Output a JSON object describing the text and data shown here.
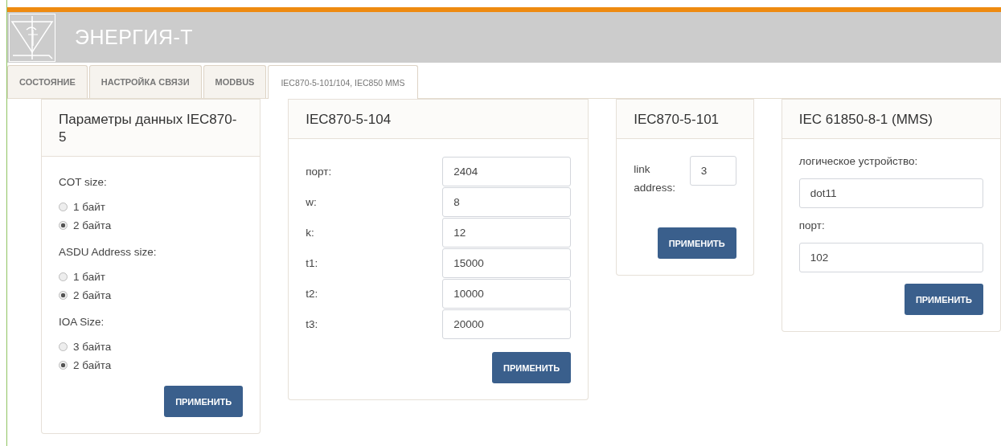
{
  "header": {
    "brand": "ЭНЕРГИЯ-Т"
  },
  "tabs": [
    {
      "label": "СОСТОЯНИЕ",
      "selected": false
    },
    {
      "label": "НАСТРОЙКА СВЯЗИ",
      "selected": false
    },
    {
      "label": "MODBUS",
      "selected": false
    },
    {
      "label": "IEC870-5-101/104, IEC850 MMS",
      "selected": true
    }
  ],
  "panels": [
    {
      "kind": "radios",
      "title": "Параметры данных IEC870-5",
      "groups": [
        {
          "label": "COT size:",
          "options": [
            {
              "label": "1 байт",
              "selected": false
            },
            {
              "label": "2 байта",
              "selected": true
            }
          ]
        },
        {
          "label": "ASDU Address size:",
          "options": [
            {
              "label": "1 байт",
              "selected": false
            },
            {
              "label": "2 байта",
              "selected": true
            }
          ]
        },
        {
          "label": "IOA Size:",
          "options": [
            {
              "label": "3 байта",
              "selected": false
            },
            {
              "label": "2 байта",
              "selected": true
            }
          ]
        }
      ],
      "button": "ПРИМЕНИТЬ"
    },
    {
      "kind": "table",
      "title": "IEC870-5-104",
      "fields": [
        {
          "label": "порт:",
          "value": "2404"
        },
        {
          "label": "w:",
          "value": "8"
        },
        {
          "label": "k:",
          "value": "12"
        },
        {
          "label": "t1:",
          "value": "15000"
        },
        {
          "label": "t2:",
          "value": "10000"
        },
        {
          "label": "t3:",
          "value": "20000"
        }
      ],
      "button": "ПРИМЕНИТЬ"
    },
    {
      "kind": "inline",
      "title": "IEC870-5-101",
      "fields": [
        {
          "label": "link address:",
          "value": "3"
        }
      ],
      "button": "ПРИМЕНИТЬ"
    },
    {
      "kind": "stacked",
      "title": "IEC 61850-8-1 (MMS)",
      "fields": [
        {
          "label": "логическое устройство:",
          "value": "dot11"
        },
        {
          "label": "порт:",
          "value": "102"
        }
      ],
      "button": "ПРИМЕНИТЬ"
    }
  ]
}
